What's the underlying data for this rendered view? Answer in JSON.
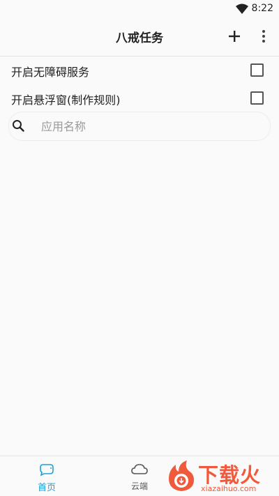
{
  "status_bar": {
    "time": "8:22",
    "icons": [
      "wifi-icon"
    ]
  },
  "app_bar": {
    "title": "八戒任务",
    "actions": [
      "add-icon",
      "more-vert-icon"
    ]
  },
  "settings": [
    {
      "label": "开启无障碍服务",
      "checked": false
    },
    {
      "label": "开启悬浮窗(制作规则)",
      "checked": false
    }
  ],
  "search": {
    "placeholder": "应用名称",
    "value": ""
  },
  "bottom_nav": {
    "items": [
      {
        "label": "首页",
        "icon": "home-icon",
        "active": true
      },
      {
        "label": "云端",
        "icon": "cloud-icon",
        "active": false
      }
    ]
  },
  "watermark": {
    "brand": "下载火",
    "site": "xiazaihuo.com"
  },
  "colors": {
    "accent": "#1e9fd6",
    "watermark": "#f05a3c"
  }
}
